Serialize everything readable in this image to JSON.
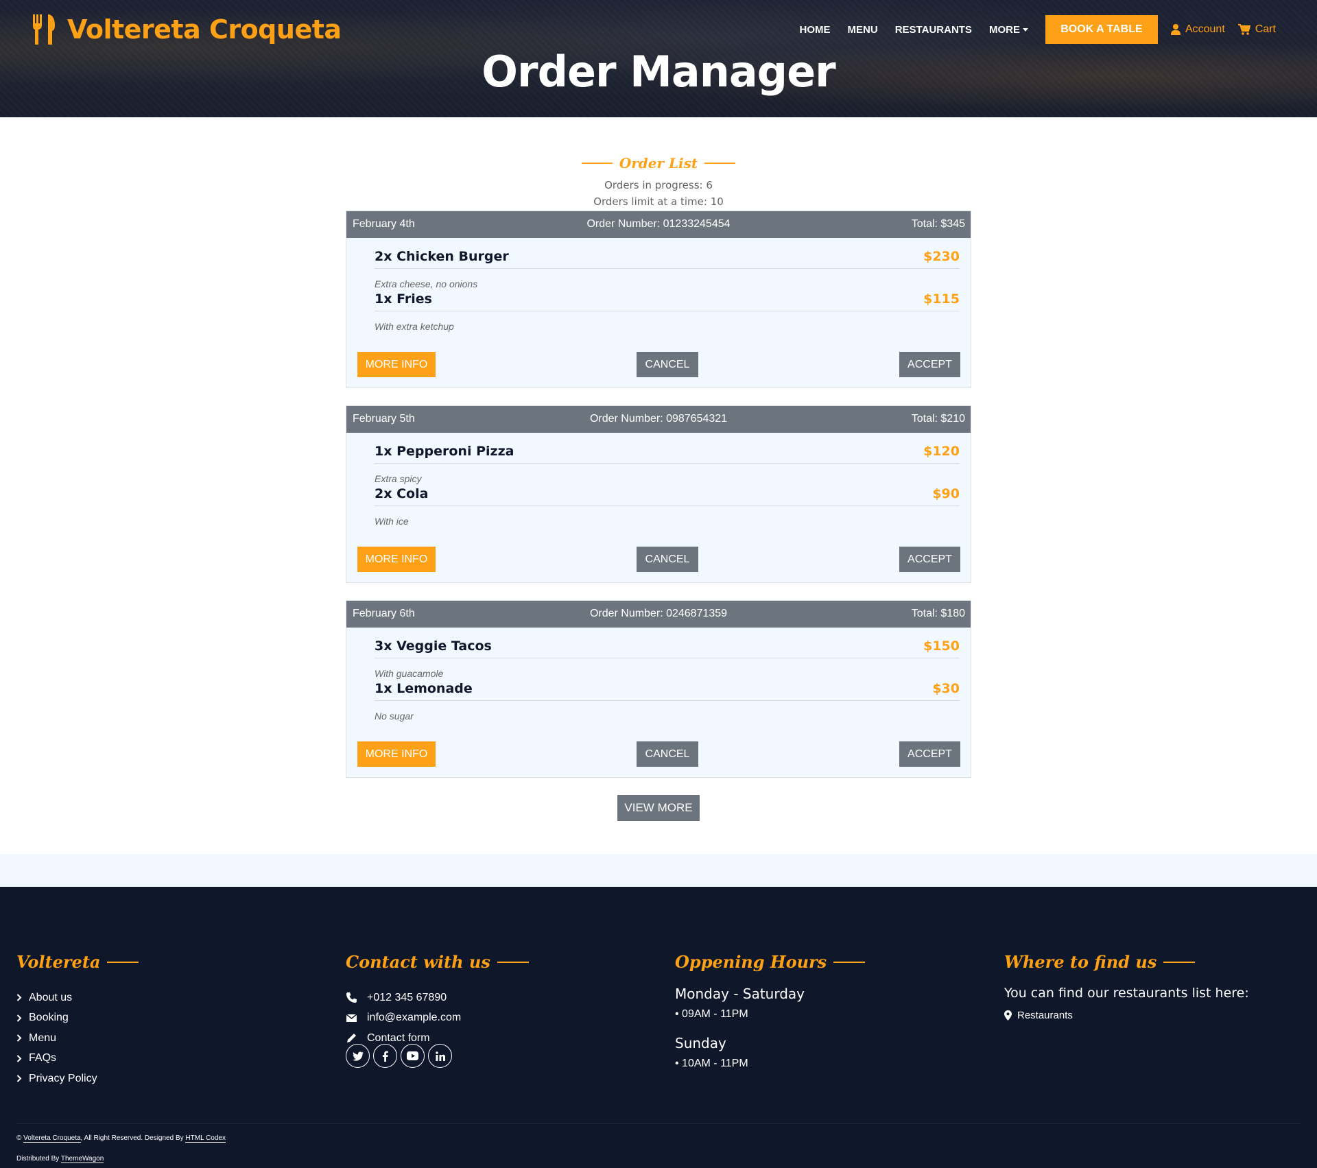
{
  "header": {
    "brand": "Voltereta Croqueta",
    "nav": {
      "home": "HOME",
      "menu": "MENU",
      "restaurants": "RESTAURANTS",
      "more": "MORE",
      "book_table": "BOOK A TABLE",
      "account": "Account",
      "cart": "Cart"
    },
    "page_title": "Order Manager"
  },
  "order_list": {
    "title": "Order List",
    "in_progress": "Orders in progress: 6",
    "limit": "Orders limit at a time: 10",
    "buttons": {
      "more_info": "MORE INFO",
      "cancel": "CANCEL",
      "accept": "ACCEPT"
    },
    "orders": [
      {
        "date": "February 4th",
        "number": "Order Number: 01233245454",
        "total": "Total: $345",
        "items": [
          {
            "name": "2x Chicken Burger",
            "price": "$230",
            "note": "Extra cheese, no onions"
          },
          {
            "name": "1x Fries",
            "price": "$115",
            "note": "With extra ketchup"
          }
        ]
      },
      {
        "date": "February 5th",
        "number": "Order Number: 0987654321",
        "total": "Total: $210",
        "items": [
          {
            "name": "1x Pepperoni Pizza",
            "price": "$120",
            "note": "Extra spicy"
          },
          {
            "name": "2x Cola",
            "price": "$90",
            "note": "With ice"
          }
        ]
      },
      {
        "date": "February 6th",
        "number": "Order Number: 0246871359",
        "total": "Total: $180",
        "items": [
          {
            "name": "3x Veggie Tacos",
            "price": "$150",
            "note": "With guacamole"
          },
          {
            "name": "1x Lemonade",
            "price": "$30",
            "note": "No sugar"
          }
        ]
      }
    ],
    "view_more": "VIEW MORE"
  },
  "footer": {
    "col1": {
      "title": "Voltereta",
      "links": [
        "About us",
        "Booking",
        "Menu",
        "FAQs",
        "Privacy Policy"
      ]
    },
    "col2": {
      "title": "Contact with us",
      "phone": "+012 345 67890",
      "email": "info@example.com",
      "form": "Contact form",
      "socials": [
        "twitter-icon",
        "facebook-icon",
        "youtube-icon",
        "linkedin-icon"
      ]
    },
    "col3": {
      "title": "Oppening Hours",
      "day1": "Monday - Saturday",
      "time1": "• 09AM - 11PM",
      "day2": "Sunday",
      "time2": "• 10AM - 11PM"
    },
    "col4": {
      "title": "Where to find us",
      "text": "You can find our restaurants list here:",
      "link": "Restaurants"
    },
    "copyright": {
      "prefix": "© ",
      "site": "Voltereta Croqueta",
      "middle": ", All Right Reserved. Designed By ",
      "designer": "HTML Codex",
      "dist_prefix": "Distributed By ",
      "distributor": "ThemeWagon"
    }
  },
  "colors": {
    "accent": "#fea116",
    "dark": "#0f172b",
    "secondary": "#6c757d",
    "light": "#f1f8ff"
  }
}
